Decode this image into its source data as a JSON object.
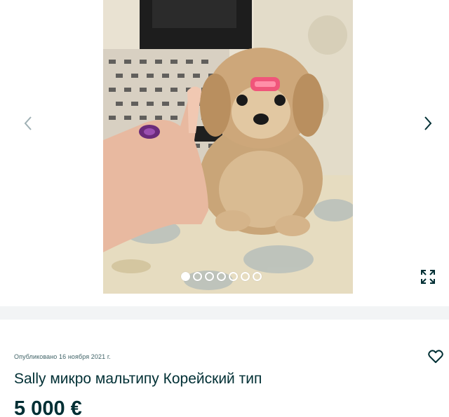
{
  "gallery": {
    "image_count": 7,
    "active_index": 0,
    "icons": {
      "prev": "chevron-left-icon",
      "next": "chevron-right-icon",
      "fullscreen": "expand-icon"
    }
  },
  "ad": {
    "published": "Опубликовано 16 ноября 2021 г.",
    "title": "Sally микро мальтипу Корейский тип",
    "price": "5 000 €",
    "favorite_icon": "heart-icon"
  },
  "colors": {
    "text_primary": "#002f34",
    "divider_bg": "#f2f4f5"
  }
}
